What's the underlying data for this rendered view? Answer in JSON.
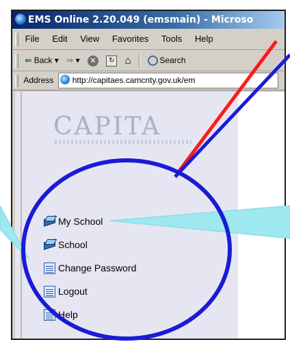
{
  "window": {
    "title": "EMS Online 2.20.049 (emsmain) - Microso"
  },
  "menu": {
    "items": [
      "File",
      "Edit",
      "View",
      "Favorites",
      "Tools",
      "Help"
    ]
  },
  "toolbar": {
    "back_label": "Back",
    "search_label": "Search"
  },
  "address": {
    "label": "Address",
    "url": "http://capitaes.camcnty.gov.uk/em"
  },
  "page": {
    "logo_text": "CAPITA",
    "nav": [
      {
        "label": "My School",
        "icon": "book-icon"
      },
      {
        "label": "School",
        "icon": "book-icon"
      },
      {
        "label": "Change Password",
        "icon": "document-icon"
      },
      {
        "label": "Logout",
        "icon": "document-icon"
      },
      {
        "label": "Help",
        "icon": "document-icon"
      }
    ]
  },
  "annotation": {
    "circle_color": "#1b1bd6",
    "red_line_color": "#ff1a1a",
    "blue_line_color": "#1b1bd6",
    "callout_color": "#9ee8f0"
  }
}
